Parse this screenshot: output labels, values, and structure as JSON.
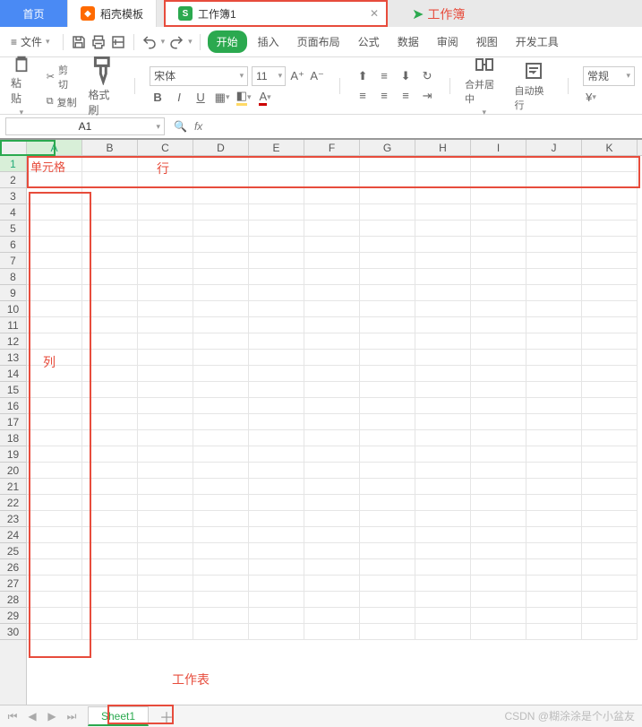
{
  "tabs": {
    "home": "首页",
    "daoke": "稻壳模板",
    "workbook": "工作簿1"
  },
  "annotations": {
    "workbook": "工作簿",
    "cell": "单元格",
    "row": "行",
    "column": "列",
    "worksheet": "工作表"
  },
  "toolbar": {
    "file": "文件"
  },
  "menu": {
    "start": "开始",
    "insert": "插入",
    "pageLayout": "页面布局",
    "formula": "公式",
    "data": "数据",
    "review": "审阅",
    "view": "视图",
    "devtools": "开发工具"
  },
  "ribbon": {
    "paste": "粘贴",
    "cut": "剪切",
    "copy": "复制",
    "formatPainter": "格式刷",
    "fontName": "宋体",
    "fontSize": "11",
    "mergeCenter": "合并居中",
    "autoWrap": "自动换行",
    "general": "常规"
  },
  "nameBox": "A1",
  "columns": [
    "A",
    "B",
    "C",
    "D",
    "E",
    "F",
    "G",
    "H",
    "I",
    "J",
    "K"
  ],
  "rows": [
    "1",
    "2",
    "3",
    "4",
    "5",
    "6",
    "7",
    "8",
    "9",
    "10",
    "11",
    "12",
    "13",
    "14",
    "15",
    "16",
    "17",
    "18",
    "19",
    "20",
    "21",
    "22",
    "23",
    "24",
    "25",
    "26",
    "27",
    "28",
    "29",
    "30"
  ],
  "sheetTab": "Sheet1",
  "watermark": "CSDN @糊涂涂是个小盆友"
}
